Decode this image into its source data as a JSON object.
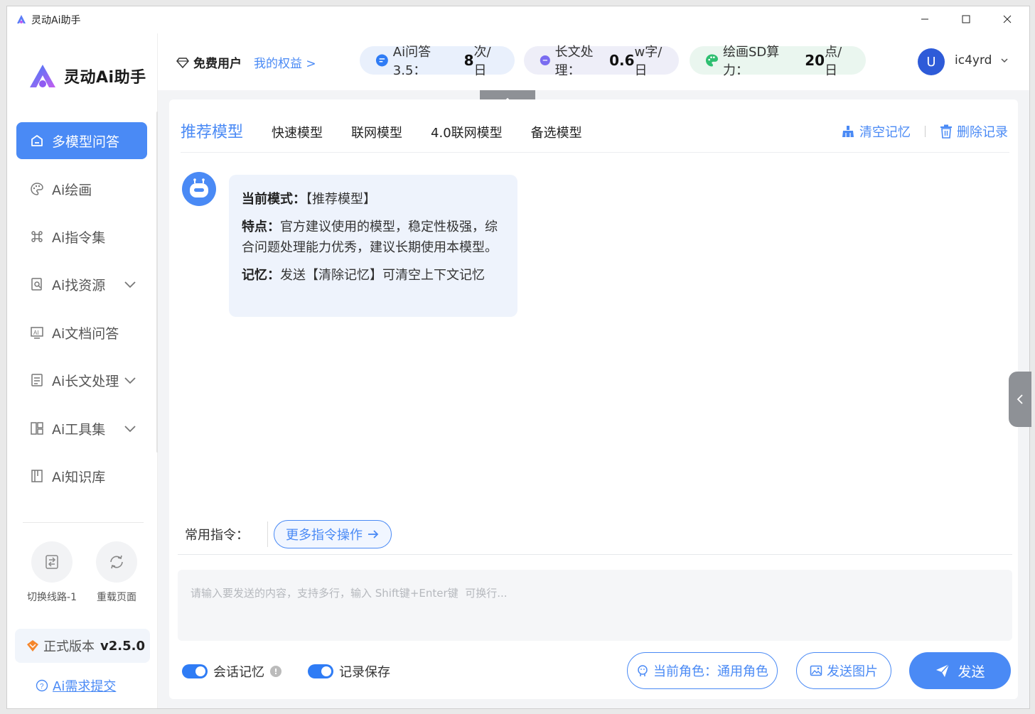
{
  "window": {
    "title": "灵动Ai助手",
    "controls": {
      "minimize": "—",
      "maximize": "☐",
      "close": "✕"
    }
  },
  "sidebar": {
    "brand": "灵动Ai助手",
    "items": [
      {
        "label": "多模型问答",
        "icon": "chat-icon",
        "active": true
      },
      {
        "label": "Ai绘画",
        "icon": "palette-icon"
      },
      {
        "label": "Ai指令集",
        "icon": "command-icon"
      },
      {
        "label": "Ai找资源",
        "icon": "search-doc-icon",
        "expandable": true
      },
      {
        "label": "Ai文档问答",
        "icon": "ai-doc-icon"
      },
      {
        "label": "Ai长文处理",
        "icon": "document-icon",
        "expandable": true
      },
      {
        "label": "Ai工具集",
        "icon": "grid-icon",
        "expandable": true
      },
      {
        "label": "Ai知识库",
        "icon": "book-icon"
      }
    ],
    "quick_actions": [
      {
        "label": "切换线路-1",
        "icon": "switch-line-icon"
      },
      {
        "label": "重载页面",
        "icon": "reload-icon"
      }
    ],
    "version_label": "正式版本",
    "version_value": "v2.5.0",
    "feedback": "Ai需求提交"
  },
  "header": {
    "user_type": "免费用户",
    "rights_link": "我的权益 >",
    "quotas": [
      {
        "label": "Ai问答3.5：",
        "value": "8",
        "unit": "次/日",
        "color": "#2f7cf5"
      },
      {
        "label": "长文处理：",
        "value": "0.6",
        "unit": "w字/日",
        "color": "#7a6cf0"
      },
      {
        "label": "绘画SD算力：",
        "value": "20",
        "unit": "点/日",
        "color": "#2fbf71"
      }
    ],
    "avatar_letter": "U",
    "username": "ic4yrd"
  },
  "tabs": {
    "items": [
      "推荐模型",
      "快速模型",
      "联网模型",
      "4.0联网模型",
      "备选模型"
    ],
    "active": 0,
    "clear_memory": "清空记忆",
    "delete_records": "删除记录"
  },
  "message": {
    "mode_label": "当前模式：",
    "mode_value": "【推荐模型】",
    "feature_label": "特点：",
    "feature_value": "官方建议使用的模型，稳定性极强，综合问题处理能力优秀，建议长期使用本模型。",
    "memory_label": "记忆：",
    "memory_value": "发送【清除记忆】可清空上下文记忆"
  },
  "commands": {
    "label": "常用指令：",
    "more": "更多指令操作"
  },
  "input": {
    "placeholder": "请输入要发送的内容，支持多行，输入 Shift键+Enter键  可换行..."
  },
  "footer": {
    "session_memory": "会话记忆",
    "session_memory_on": true,
    "record_save": "记录保存",
    "record_save_on": true,
    "role_button": "当前角色：通用角色",
    "send_image": "发送图片",
    "send": "发送"
  }
}
